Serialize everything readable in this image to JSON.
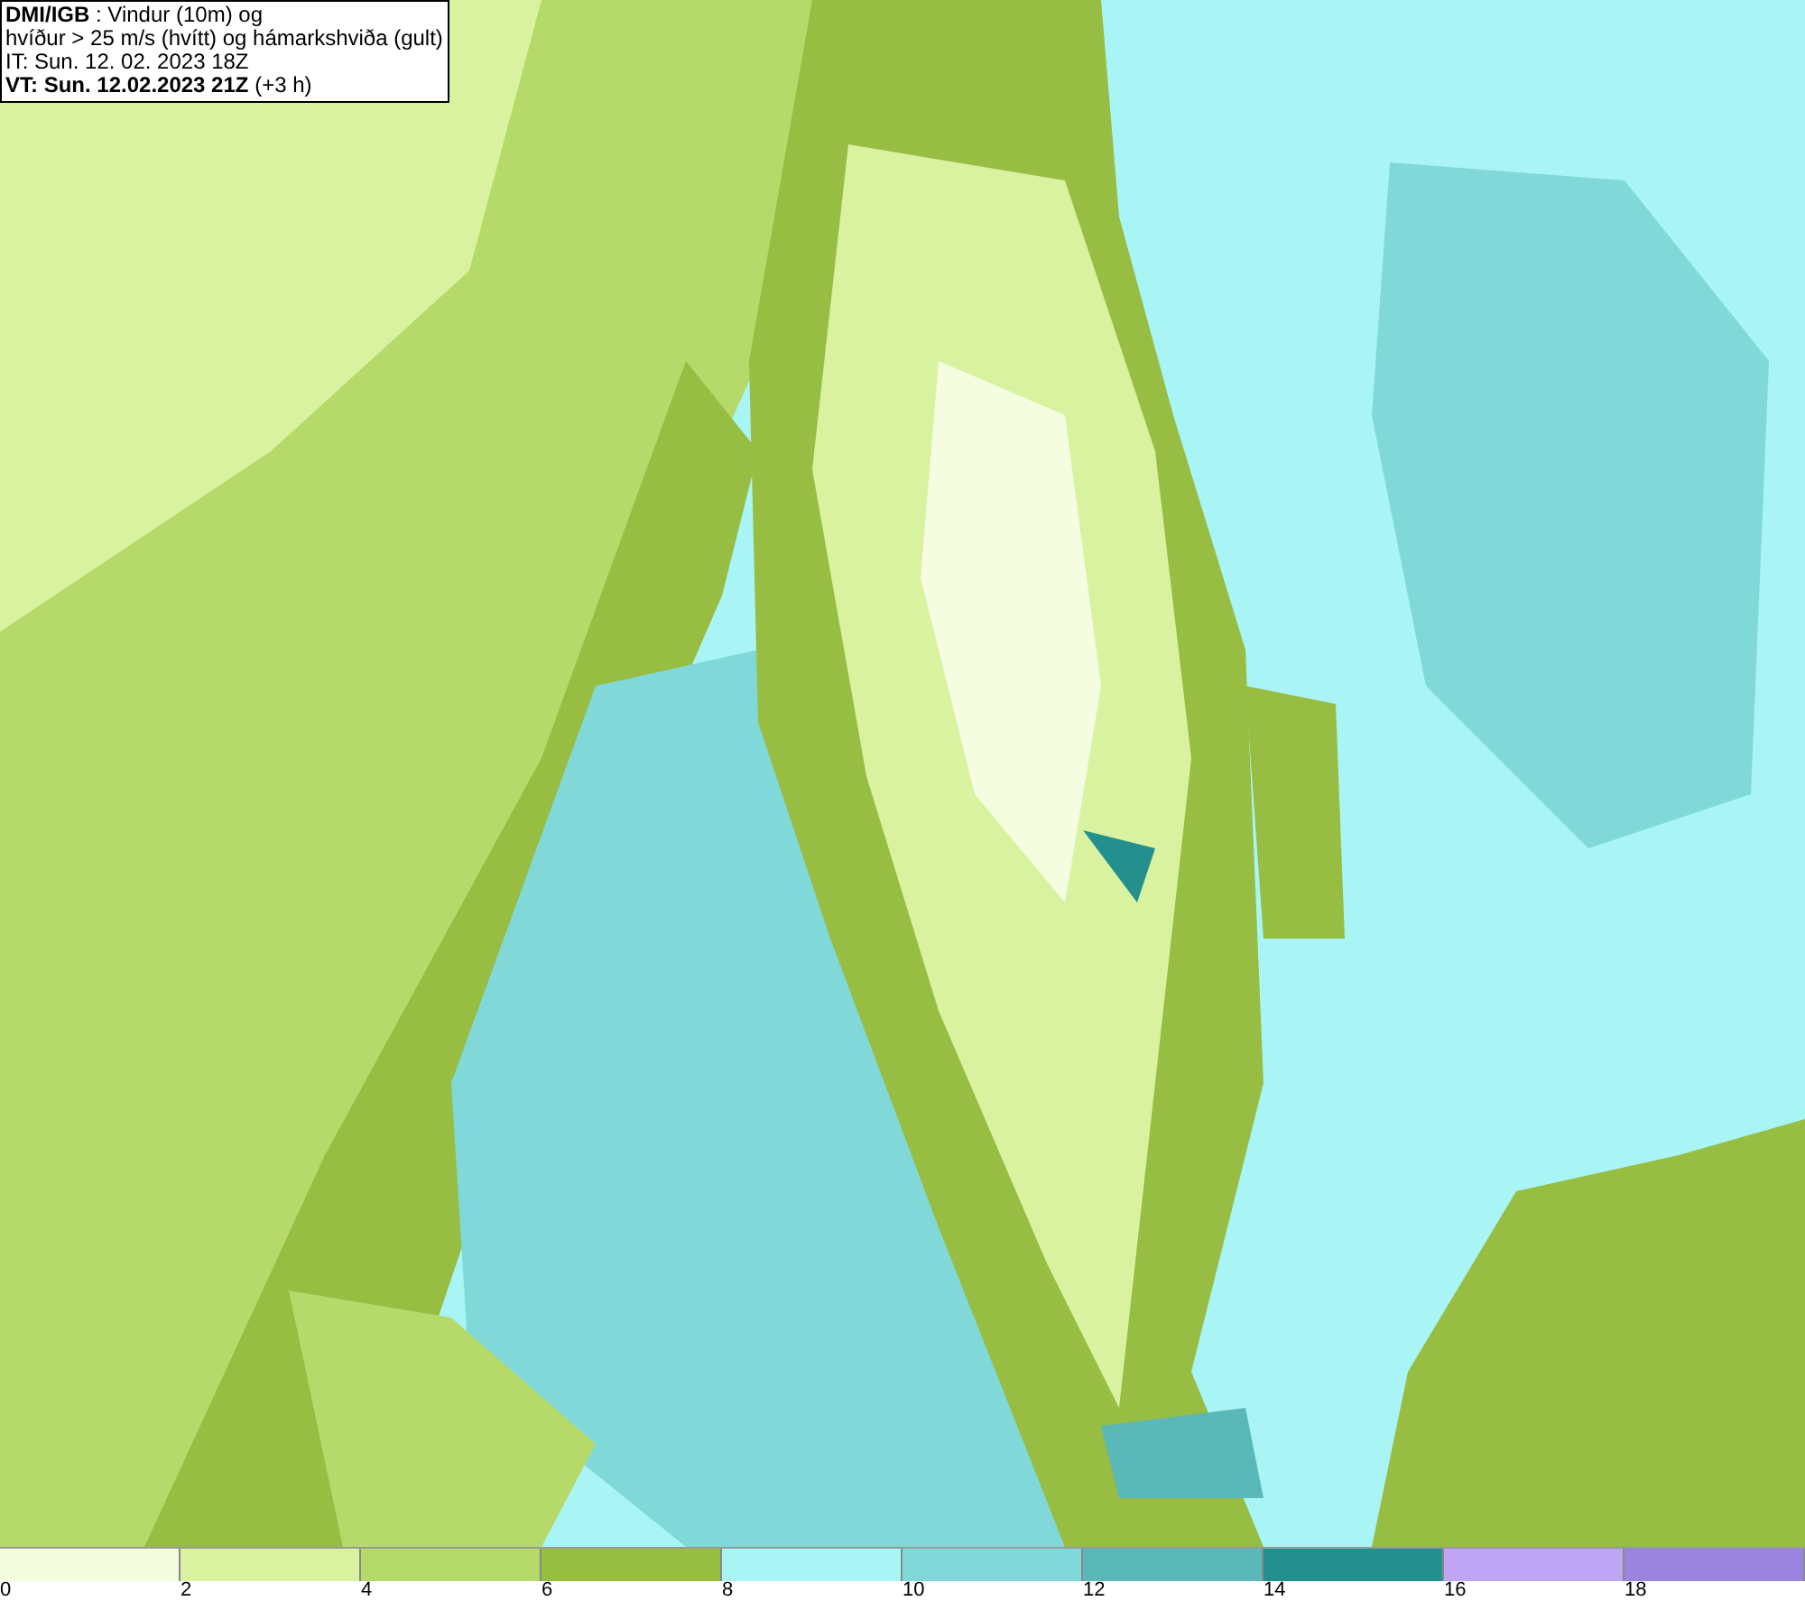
{
  "header": {
    "lines": [
      "**DMI/IGB** : Vindur (10m) og",
      "hvíður > 25 m/s (hvítt) og hámarkshviða (gult)",
      "IT: Sun. 12. 02. 2023 18Z",
      "**VT: Sun. 12.02.2023 21Z** (+3 h)"
    ]
  },
  "legend": {
    "bins": [
      {
        "color": "#f4fde0",
        "label": "0"
      },
      {
        "color": "#d8f2a0",
        "label": "2"
      },
      {
        "color": "#b5da6a",
        "label": "4"
      },
      {
        "color": "#97bd43",
        "label": "6"
      },
      {
        "color": "#a9f5f5",
        "label": "8"
      },
      {
        "color": "#80d8d8",
        "label": "10"
      },
      {
        "color": "#5ab8b8",
        "label": "12"
      },
      {
        "color": "#24908e",
        "label": "14"
      },
      {
        "color": "#bfa6f4",
        "label": "16"
      },
      {
        "color": "#9a84e0",
        "label": "18"
      }
    ]
  }
}
